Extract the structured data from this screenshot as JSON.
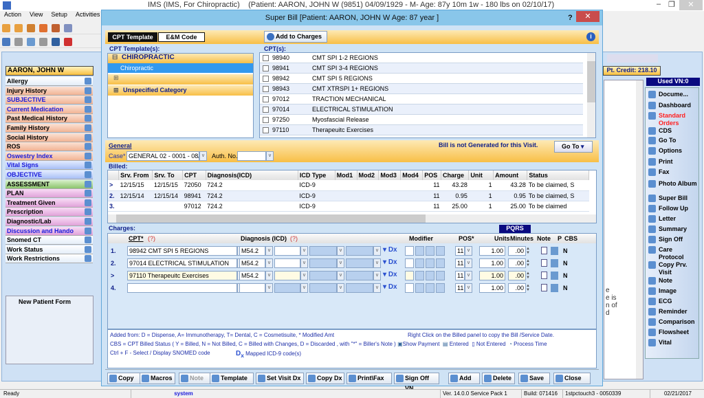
{
  "app": {
    "title": "IMS (IMS, For Chiropractic)    (Patient: AARON, JOHN W (9851) 04/09/1929 - M- Age: 87y 10m 1w - 180 lbs on 02/10/17)",
    "menu": [
      "Action",
      "View",
      "Setup",
      "Activities"
    ],
    "patient_name": "AARON, JOHN W",
    "pt_credit": "Pt. Credit: 218.10",
    "used_vn": "Used VN:0",
    "new_patient_form": "New Patient Form",
    "bg_text": [
      "e",
      "e is",
      "n of",
      "d"
    ]
  },
  "sidebar": {
    "items": [
      {
        "label": "Allergy",
        "style": "white",
        "blue": false
      },
      {
        "label": "Injury History",
        "style": "peach",
        "blue": false
      },
      {
        "label": "SUBJECTIVE",
        "style": "peach",
        "blue": true
      },
      {
        "label": "Current Medication",
        "style": "peach",
        "blue": true
      },
      {
        "label": "Past Medical History",
        "style": "peach",
        "blue": false
      },
      {
        "label": "Family History",
        "style": "peach",
        "blue": false
      },
      {
        "label": "Social History",
        "style": "peach",
        "blue": false
      },
      {
        "label": "ROS",
        "style": "peach",
        "blue": false
      },
      {
        "label": "Oswestry Index",
        "style": "peach",
        "blue": true
      },
      {
        "label": "Vital Signs",
        "style": "blue",
        "blue": true
      },
      {
        "label": "OBJECTIVE",
        "style": "blue",
        "blue": true
      },
      {
        "label": "ASSESSMENT",
        "style": "green",
        "blue": false
      },
      {
        "label": "PLAN",
        "style": "pink",
        "blue": false
      },
      {
        "label": "Treatment Given",
        "style": "pink",
        "blue": false
      },
      {
        "label": "Prescription",
        "style": "pink",
        "blue": false
      },
      {
        "label": "Diagnostic/Lab",
        "style": "pink",
        "blue": false
      },
      {
        "label": "Discussion and Hando",
        "style": "pink",
        "blue": true
      },
      {
        "label": "Snomed CT",
        "style": "white",
        "blue": false
      },
      {
        "label": "Work Status",
        "style": "white",
        "blue": false
      },
      {
        "label": "Work Restrictions",
        "style": "white",
        "blue": false
      }
    ]
  },
  "right_panel": {
    "items": [
      "Docume...",
      "Dashboard",
      "Standard Orders",
      "CDS",
      "Go To",
      "Options",
      "Print",
      "Fax",
      "Photo Album",
      "Super Bill",
      "Follow Up",
      "Letter",
      "Summary",
      "Sign Off",
      "Care Protocol",
      "Copy Prv. Visit",
      "Note",
      "Image",
      "ECG",
      "Reminder",
      "Comparison",
      "Flowsheet",
      "Vital"
    ],
    "highlight_color": "#ff2020"
  },
  "dialog": {
    "title": "Super Bill  [Patient: AARON, JOHN W  Age: 87 year ]",
    "help": "?",
    "tabs": [
      "CPT Template",
      "E&M Code"
    ],
    "add_to_charges": "Add to Charges",
    "templates_label": "CPT Template(s):",
    "templates": [
      {
        "label": "CHIROPRACTIC",
        "expanded": true,
        "child": "Chiropractic"
      },
      {
        "label": "",
        "expanded": false
      },
      {
        "label": "Unspecified Category",
        "expanded": false
      }
    ],
    "cpts_label": "CPT(s):",
    "cpts": [
      [
        "98940",
        "CMT SPI 1-2 REGIONS"
      ],
      [
        "98941",
        "CMT SPI 3-4 REGIONS"
      ],
      [
        "98942",
        "CMT SPI 5 REGIONS"
      ],
      [
        "98943",
        "CMT XTRSPI 1+ REGIONS"
      ],
      [
        "97012",
        "TRACTION MECHANICAL"
      ],
      [
        "97014",
        "ELECTRICAL STIMULATION"
      ],
      [
        "97250",
        "Myosfascial Release"
      ],
      [
        "97110",
        "Therapeuitc Exercises"
      ]
    ],
    "general": {
      "label": "General",
      "case_label": "Case*",
      "case_value": "GENERAL 02  -  0001 - 08/",
      "auth_label": "Auth. No.:",
      "auth_value": "",
      "bill_status": "Bill is not Generated for this Visit.",
      "goto": "Go To"
    },
    "billed": {
      "label": "Billed:",
      "columns": [
        "",
        "Srv. From",
        "Srv. To",
        "CPT",
        "Diagnosis(ICD)",
        "ICD Type",
        "Mod1",
        "Mod2",
        "Mod3",
        "Mod4",
        "POS",
        "Charge",
        "Unit",
        "Amount",
        "Status"
      ],
      "rows": [
        [
          ">",
          "12/15/15",
          "12/15/15",
          "72050",
          "724.2",
          "ICD-9",
          "",
          "",
          "",
          "",
          "11",
          "43.28",
          "1",
          "43.28",
          "To be claimed, S"
        ],
        [
          "2.",
          "12/15/14",
          "12/15/14",
          "98941",
          "724.2",
          "ICD-9",
          "",
          "",
          "",
          "",
          "11",
          "0.95",
          "1",
          "0.95",
          "To be claimed, S"
        ],
        [
          "3.",
          "",
          "",
          "97012",
          "724.2",
          "ICD-9",
          "",
          "",
          "",
          "",
          "11",
          "25.00",
          "1",
          "25.00",
          "To be claimed"
        ]
      ]
    },
    "charges": {
      "label": "Charges:",
      "pqrs": "PQRS",
      "columns": {
        "cpt": "CPT*",
        "q": "(?)",
        "dx": "Diagnosis (ICD)",
        "modifier": "Modifier",
        "pos": "POS*",
        "units": "Units",
        "minutes": "Minutes",
        "note": "Note",
        "p": "P",
        "cbs": "CBS"
      },
      "rows": [
        {
          "n": "1.",
          "cpt": "98942    CMT SPI 5 REGIONS",
          "dx": "M54.2",
          "pos": "11",
          "units": "1.00",
          "minutes": ".00",
          "cbs": "N"
        },
        {
          "n": "2.",
          "cpt": "97014    ELECTRICAL STIMULATION",
          "dx": "M54.2",
          "pos": "11",
          "units": "1.00",
          "minutes": ".00",
          "cbs": "N"
        },
        {
          "n": ">",
          "cpt": "97110    Therapeuitc Exercises",
          "dx": "M54.2",
          "pos": "11",
          "units": "1.00",
          "minutes": ".00",
          "cbs": "N"
        },
        {
          "n": "4.",
          "cpt": "",
          "dx": "",
          "pos": "11",
          "units": "1.00",
          "minutes": ".00",
          "cbs": "N"
        }
      ],
      "dx_icon": "Dx"
    },
    "legend": {
      "line1": "Added from: D = Dispense, A= Immunotherapy, T= Dental,  C = Cosmetisuite,   * Modified Amt",
      "copy_hint": "Right Click on the Billed panel to copy the Bill /Service Date.",
      "line2": "CBS = CPT Billed Status ( Y = Billed, N = Not Billed, C = Billed with Changes, D = Discarded , with \"*\" = Biller's Note )",
      "show_payment": "Show Payment",
      "entered": "Entered",
      "not_entered": "Not Entered",
      "process_time": "Process Time",
      "line3": "Ctrl + F - Select / Display SNOMED code",
      "mapped": "Mapped ICD-9 code(s)"
    },
    "buttons": [
      "Copy",
      "Macros",
      "Note",
      "Template",
      "Set Visit Dx",
      "Copy Dx",
      "Print\\Fax",
      "Sign Off VN",
      "Add",
      "Delete",
      "Save",
      "Close"
    ]
  },
  "statusbar": {
    "ready": "Ready",
    "user": "system",
    "version": "Ver. 14.0.0 Service Pack 1",
    "build": "Build: 071416",
    "server": "1stpctouch3 - 0050339",
    "date": "02/21/2017"
  }
}
